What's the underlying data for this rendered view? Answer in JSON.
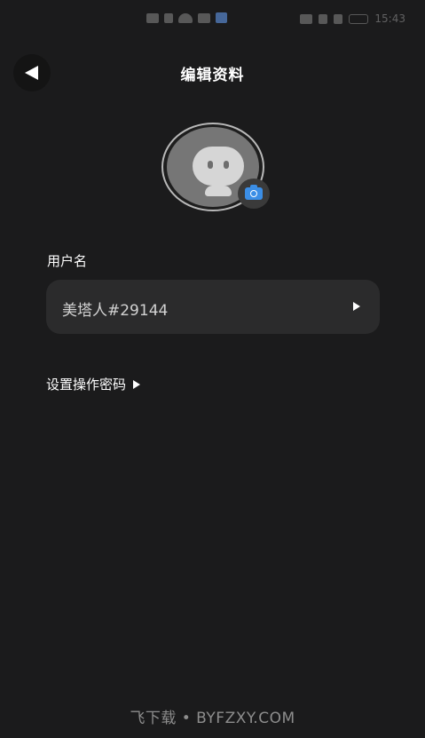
{
  "status_bar": {
    "time": "15:43",
    "icons": [
      "sim-icon",
      "signal-icon",
      "wifi-icon",
      "notification-app-icon",
      "eye-icon",
      "nfc-icon",
      "alarm-icon",
      "battery-icon"
    ]
  },
  "header": {
    "title": "编辑资料",
    "back_icon": "back-arrow-icon"
  },
  "avatar": {
    "image": "default-robot-avatar",
    "camera_icon": "camera-icon",
    "accent_color": "#3b8ee6"
  },
  "username": {
    "label": "用户名",
    "value": "美塔人#29144"
  },
  "password": {
    "label": "设置操作密码"
  },
  "watermark": "飞下载 • BYFZXY.COM"
}
